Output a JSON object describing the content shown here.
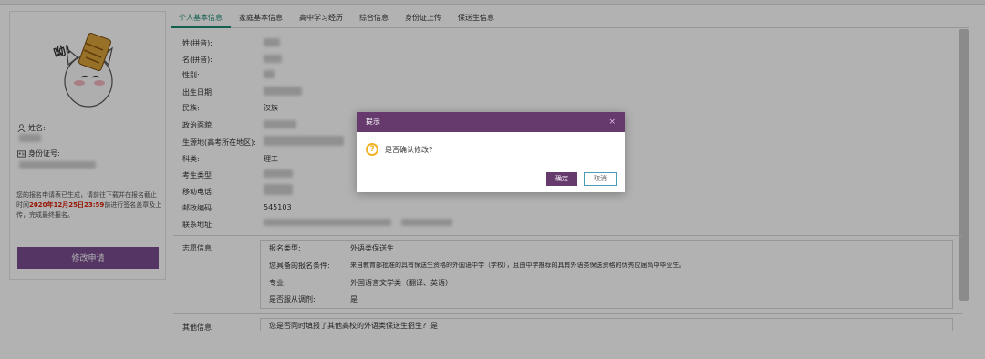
{
  "profile": {
    "name_label": "姓名:",
    "id_label": "身份证号:",
    "notice_pre": "您的报名申请表已生成，请前往下载并在报名截止时间",
    "notice_deadline": "2020年12月25日23:59",
    "notice_post": "前进行签名盖章及上传，完成最终报名。",
    "modify_button": "修改申请",
    "avatar_caption": "呦!"
  },
  "tabs": [
    "个人基本信息",
    "家庭基本信息",
    "高中学习经历",
    "综合信息",
    "身份证上传",
    "保送生信息"
  ],
  "basic_info": {
    "surname_label": "姓(拼音):",
    "given_name_label": "名(拼音):",
    "gender_label": "性别:",
    "birthdate_label": "出生日期:",
    "ethnicity_label": "民族:",
    "ethnicity_value": "汉族",
    "political_label": "政治面貌:",
    "origin_label": "生源地(高考所在地区):",
    "subject_label": "科类:",
    "subject_value": "理工",
    "exam_type_label": "考生类型:",
    "mobile_label": "移动电话:",
    "postcode_label": "邮政编码:",
    "postcode_value": "545103",
    "address_label": "联系地址:"
  },
  "application": {
    "label": "志愿信息:",
    "type_label": "报名类型:",
    "type_value": "外语类保送生",
    "condition_label": "您具备的报名条件:",
    "condition_value": "来自教育部批准的具有保送生资格的外国语中学（学校），且由中学推荐的具有外语类保送资格的优秀应届高中毕业生。",
    "major_label": "专业:",
    "major_value": "外国语言文学类（翻译、英语）",
    "adjust_label": "是否服从调剂:",
    "adjust_value": "是"
  },
  "other": {
    "label": "其他信息:",
    "question": "您是否同时填报了其他高校的外语类保送生招生?",
    "answer": "是"
  },
  "modal": {
    "title": "提示",
    "close": "×",
    "message": "是否确认修改?",
    "ok": "确定",
    "cancel": "取消",
    "icon": "question-icon"
  },
  "colors": {
    "accent": "#663a6d",
    "tab_active": "#1a8a73",
    "deadline": "#d81e06"
  }
}
